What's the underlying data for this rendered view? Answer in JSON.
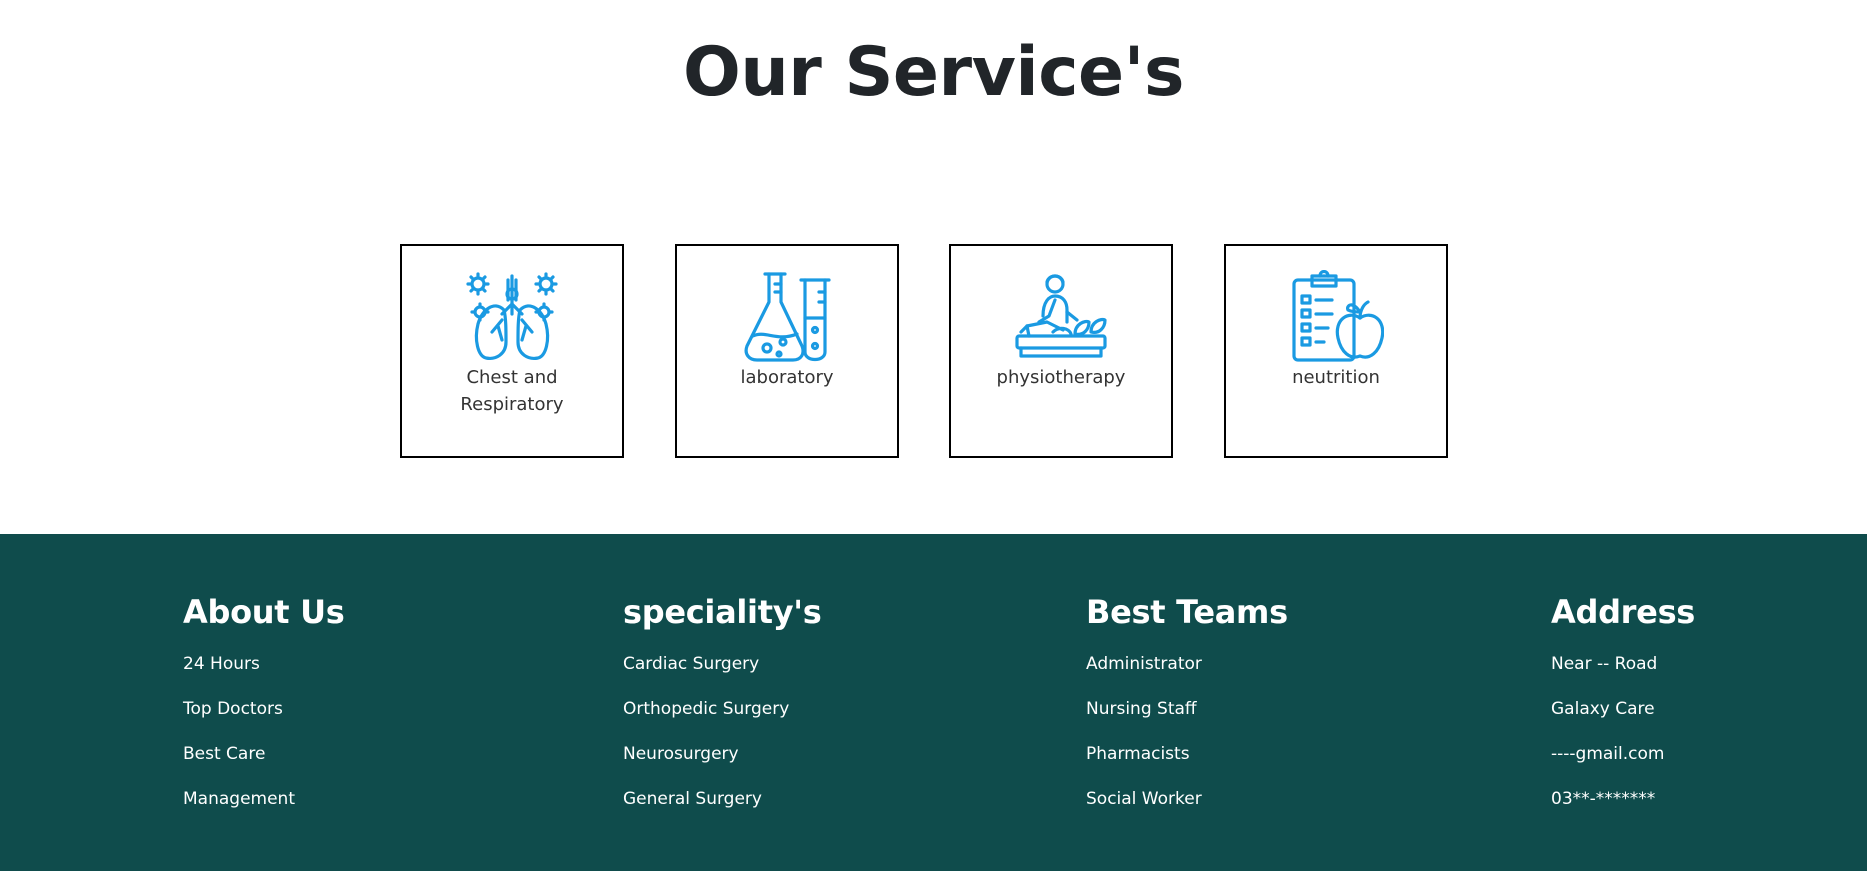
{
  "services": {
    "title": "Our Service's",
    "cards": [
      {
        "label": "Chest and Respiratory",
        "icon": "lungs-icon"
      },
      {
        "label": "laboratory",
        "icon": "lab-flask-icon"
      },
      {
        "label": "physiotherapy",
        "icon": "physiotherapy-icon"
      },
      {
        "label": "neutrition",
        "icon": "nutrition-clipboard-apple-icon"
      }
    ],
    "icon_color": "#1a9ae2"
  },
  "footer": {
    "background": "#0f4c4c",
    "columns": [
      {
        "title": "About Us",
        "items": [
          "24 Hours",
          "Top Doctors",
          "Best Care",
          "Management"
        ]
      },
      {
        "title": "speciality's",
        "items": [
          "Cardiac Surgery",
          "Orthopedic Surgery",
          "Neurosurgery",
          "General Surgery"
        ]
      },
      {
        "title": "Best Teams",
        "items": [
          "Administrator",
          "Nursing Staff",
          "Pharmacists",
          "Social Worker"
        ]
      },
      {
        "title": "Address",
        "items": [
          "Near -- Road",
          "Galaxy Care",
          "----gmail.com",
          "03**-*******"
        ]
      }
    ]
  }
}
